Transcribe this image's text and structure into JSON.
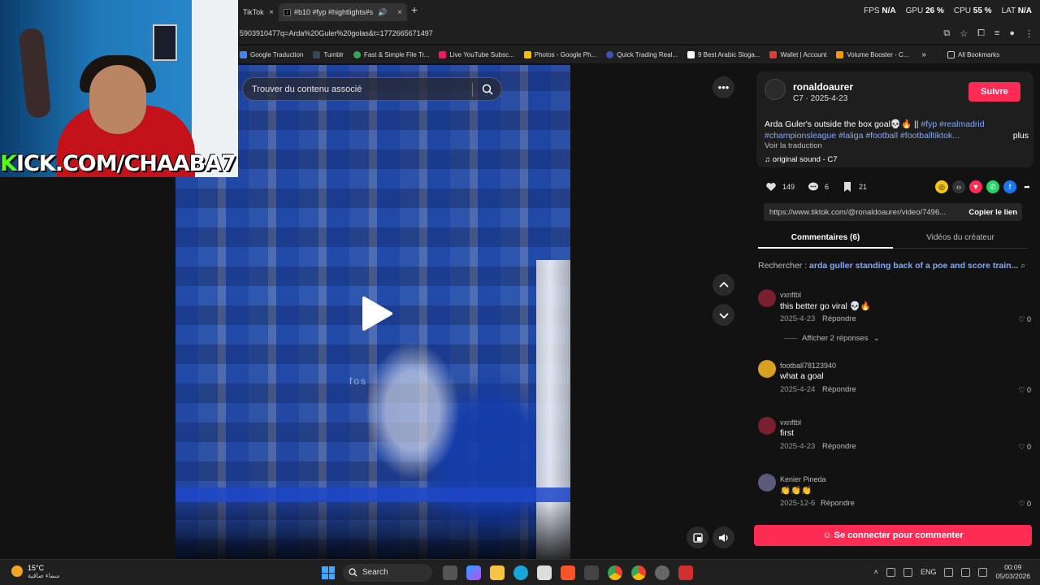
{
  "browser": {
    "tabs": [
      {
        "label": "TikTok"
      },
      {
        "label": "#b10 #fyp #hightlights#s"
      }
    ],
    "new_tab": "+",
    "close": "×",
    "url": "5903910477q=Arda%20Guler%20golas&t=1772665671497",
    "perf": {
      "fps_label": "FPS",
      "fps_value": "N/A",
      "gpu_label": "GPU",
      "gpu_value": "26 %",
      "cpu_label": "CPU",
      "cpu_value": "55 %",
      "lat_label": "LAT",
      "lat_value": "N/A"
    },
    "bookmarks": [
      {
        "label": "Google Traduction",
        "color": "#4285f4"
      },
      {
        "label": "Tumblr",
        "color": "#001935"
      },
      {
        "label": "Fast & Simple File Tr...",
        "color": "#34a853"
      },
      {
        "label": "Live YouTube Subsc...",
        "color": "#e91e63"
      },
      {
        "label": "Photos - Google Ph...",
        "color": "#fbbc05"
      },
      {
        "label": "Quick Trading Real...",
        "color": "#3f51b5"
      },
      {
        "label": "9 Best Arabic Sloga...",
        "color": "#ffffff"
      },
      {
        "label": "Wallet | Account",
        "color": "#e53935"
      },
      {
        "label": "Volume Booster - C...",
        "color": "#ff9800"
      }
    ],
    "bookmarks_more": "»",
    "all_bookmarks": "All Bookmarks"
  },
  "webcam": {
    "overlay_text_k": "K",
    "overlay_text_rest": "ICK.COM/CHAABA7"
  },
  "video": {
    "search_placeholder": "Trouver du contenu associé",
    "watermark": "fos"
  },
  "post": {
    "username": "ronaldoaurer",
    "meta": "C7 · 2025-4-23",
    "follow": "Suivre",
    "desc_text": "Arda Guler's outside the box goal💀🔥 || ",
    "desc_tags_1": "#fyp #realmadrid",
    "desc_tags_2": "#championsleague #laliga #football #footballtiktok...",
    "more": "plus",
    "translate": "Voir la traduction",
    "sound": "♫  original sound - C7",
    "likes": "149",
    "comments": "6",
    "saves": "21",
    "link": "https://www.tiktok.com/@ronaldoaurer/video/7496...",
    "copy_link": "Copier le lien",
    "tab_comments": "Commentaires (6)",
    "tab_videos": "Vidéos du créateur",
    "search_label": "Rechercher : ",
    "search_query": "arda guller standing back of a poe and score train...",
    "login": "Se connecter pour commenter",
    "reply_label": "Répondre",
    "show_replies": "Afficher 2 réponses"
  },
  "comments": [
    {
      "user": "vxnftbl",
      "text": "this better go viral 💀🔥",
      "date": "2025-4-23",
      "likes": "0",
      "avatar_color": "#7a1f2e"
    },
    {
      "user": "football78123940",
      "text": "what a goal",
      "date": "2025-4-24",
      "likes": "0",
      "avatar_color": "#d9a020"
    },
    {
      "user": "vxnftbl",
      "text": "first",
      "date": "2025-4-23",
      "likes": "0",
      "avatar_color": "#7a1f2e"
    },
    {
      "user": "Kenier Pineda",
      "text": "👏👏👏",
      "date": "2025-12-6",
      "likes": "0",
      "avatar_color": "#5a5a7a"
    }
  ],
  "taskbar": {
    "temp": "15°C",
    "weather": "سماء صافية",
    "search": "Search",
    "lang": "ENG",
    "time": "00:09",
    "date": "05/03/2026"
  },
  "colors": {
    "accent": "#fe2c55",
    "link": "#7fa9ff",
    "kick_green": "#53fc18"
  }
}
